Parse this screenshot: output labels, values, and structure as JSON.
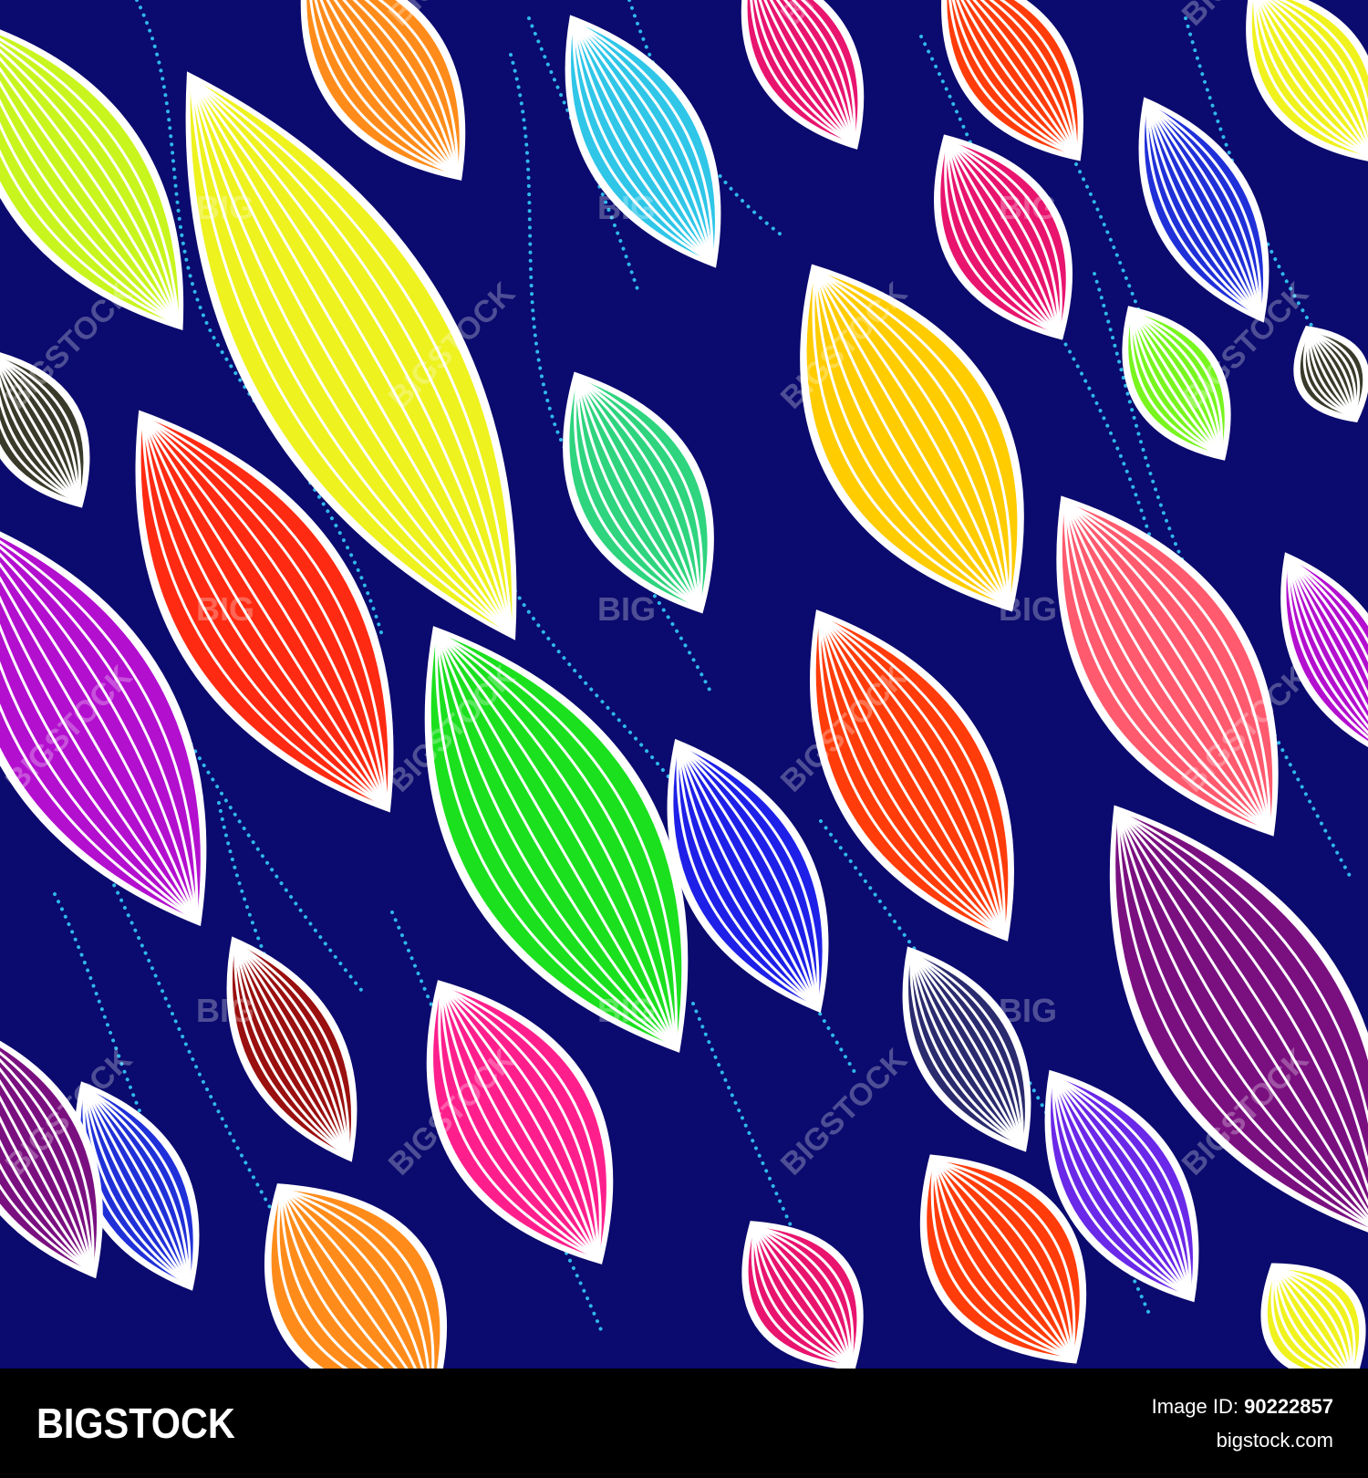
{
  "artwork": {
    "background_color": "#0b0a6e",
    "dot_color": "#2fb8e8",
    "vein_color": "#ffffff",
    "leaf_colors": [
      "#c8f51e",
      "#ff8c1a",
      "#2fc6e8",
      "#e8146e",
      "#ff3c0a",
      "#eef21e",
      "#ff2a12",
      "#2ed47e",
      "#ffcc00",
      "#ff5a6e",
      "#2030d8",
      "#78f51e",
      "#b30fcf",
      "#1be01e",
      "#1e20e8",
      "#ff1f8c",
      "#9a0f0f",
      "#2a2a6e",
      "#7a1080",
      "#6a28e8",
      "#f0f21e",
      "#3a3a2a"
    ],
    "watermark_text": "BIGSTOCK",
    "watermark_short": "BIG"
  },
  "footer": {
    "brand": "BIGSTOCK",
    "image_id_label": "Image ID:",
    "image_id_value": "90222857",
    "site": "bigstock.com"
  }
}
